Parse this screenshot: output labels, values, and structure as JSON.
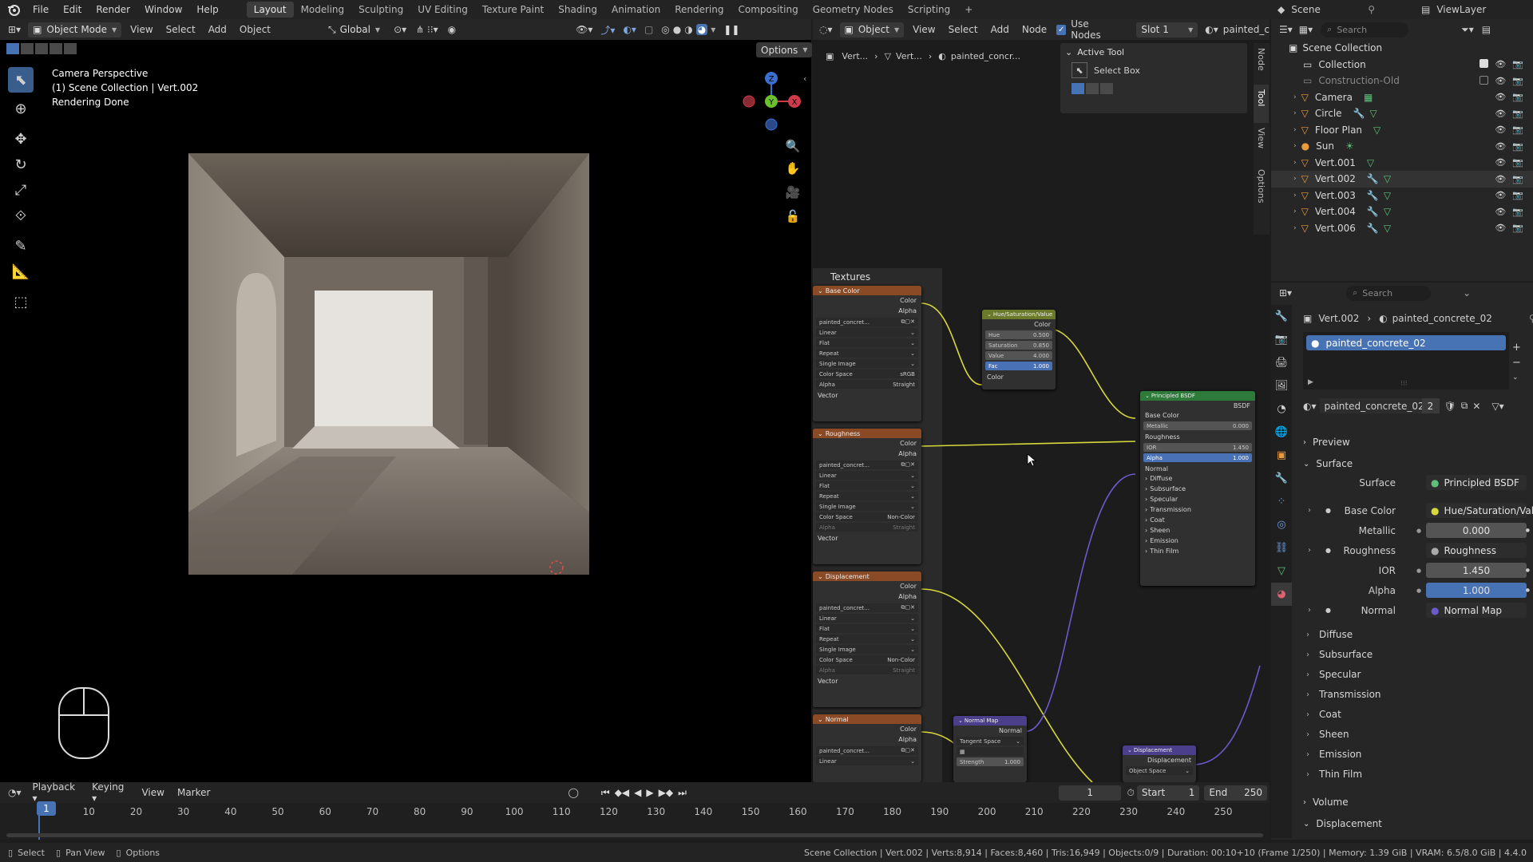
{
  "topbar": {
    "menus": [
      "File",
      "Edit",
      "Render",
      "Window",
      "Help"
    ],
    "workspaces": [
      "Layout",
      "Modeling",
      "Sculpting",
      "UV Editing",
      "Texture Paint",
      "Shading",
      "Animation",
      "Rendering",
      "Compositing",
      "Geometry Nodes",
      "Scripting"
    ],
    "active_workspace": "Layout",
    "scene": "Scene",
    "view_layer": "ViewLayer"
  },
  "viewport": {
    "mode": "Object Mode",
    "menus": [
      "View",
      "Select",
      "Add",
      "Object"
    ],
    "transform": "Global",
    "options_label": "Options",
    "info_line1": "Camera Perspective",
    "info_line2": "(1) Scene Collection | Vert.002",
    "info_line3": "Rendering Done",
    "gizmo_z": "Z",
    "gizmo_y": "Y",
    "gizmo_x": "X"
  },
  "node_editor": {
    "editor_type": "Object",
    "menus": [
      "View",
      "Select",
      "Add",
      "Node"
    ],
    "use_nodes_label": "Use Nodes",
    "slot": "Slot 1",
    "material_short": "painted_c",
    "breadcrumb": [
      "Vert...",
      "Vert...",
      "painted_concr..."
    ],
    "active_tool_title": "Active Tool",
    "select_box_label": "Select Box",
    "side_tabs": [
      "Node",
      "Tool",
      "View",
      "Options"
    ],
    "frame_label": "Textures",
    "texture_nodes": [
      {
        "title": "Base Color",
        "image": "painted_concret...",
        "interp": "Linear",
        "proj": "Flat",
        "ext": "Repeat",
        "source": "Single Image",
        "color_space_label": "Color Space",
        "color_space": "sRGB",
        "alpha_label": "Alpha",
        "alpha": "Straight",
        "vector": "Vector"
      },
      {
        "title": "Roughness",
        "image": "painted_concret...",
        "interp": "Linear",
        "proj": "Flat",
        "ext": "Repeat",
        "source": "Single Image",
        "color_space_label": "Color Space",
        "color_space": "Non-Color",
        "alpha_label": "Alpha",
        "alpha": "Straight",
        "vector": "Vector"
      },
      {
        "title": "Displacement",
        "image": "painted_concret...",
        "interp": "Linear",
        "proj": "Flat",
        "ext": "Repeat",
        "source": "Single Image",
        "color_space_label": "Color Space",
        "color_space": "Non-Color",
        "alpha_label": "Alpha",
        "alpha": "Straight",
        "vector": "Vector"
      },
      {
        "title": "Normal",
        "image": "painted_concret...",
        "interp": "Linear"
      }
    ],
    "output_color": "Color",
    "output_alpha": "Alpha",
    "hsv": {
      "title": "Hue/Saturation/Value",
      "out": "Color",
      "hue_label": "Hue",
      "hue": "0.500",
      "sat_label": "Saturation",
      "sat": "0.850",
      "val_label": "Value",
      "val": "4.000",
      "fac_label": "Fac",
      "fac": "1.000",
      "in": "Color"
    },
    "bsdf": {
      "title": "Principled BSDF",
      "out": "BSDF",
      "base_color": "Base Color",
      "metallic_label": "Metallic",
      "metallic": "0.000",
      "roughness": "Roughness",
      "ior_label": "IOR",
      "ior": "1.450",
      "alpha_label": "Alpha",
      "alpha": "1.000",
      "normal": "Normal",
      "panels": [
        "Diffuse",
        "Subsurface",
        "Specular",
        "Transmission",
        "Coat",
        "Sheen",
        "Emission",
        "Thin Film"
      ]
    },
    "normal_map": {
      "title": "Normal Map",
      "out": "Normal",
      "space": "Tangent Space",
      "strength_label": "Strength",
      "strength": "1.000"
    },
    "displacement": {
      "title": "Displacement",
      "out": "Displacement",
      "space": "Object Space"
    }
  },
  "outliner": {
    "search_placeholder": "Search",
    "root": "Scene Collection",
    "items": [
      {
        "name": "Collection",
        "type": "collection"
      },
      {
        "name": "Construction-Old",
        "type": "collection-off"
      },
      {
        "name": "Camera",
        "type": "camera"
      },
      {
        "name": "Circle",
        "type": "mesh"
      },
      {
        "name": "Floor Plan",
        "type": "mesh"
      },
      {
        "name": "Sun",
        "type": "light"
      },
      {
        "name": "Vert.001",
        "type": "mesh"
      },
      {
        "name": "Vert.002",
        "type": "mesh"
      },
      {
        "name": "Vert.003",
        "type": "mesh"
      },
      {
        "name": "Vert.004",
        "type": "mesh"
      },
      {
        "name": "Vert.006",
        "type": "mesh"
      }
    ]
  },
  "properties": {
    "search_placeholder": "Search",
    "breadcrumb_object": "Vert.002",
    "breadcrumb_material": "painted_concrete_02",
    "slot_name": "painted_concrete_02",
    "material_name": "painted_concrete_02",
    "users": "2",
    "preview": "Preview",
    "surface_section": "Surface",
    "rows": [
      {
        "label": "Surface",
        "value": "Principled BSDF"
      },
      {
        "label": "Base Color",
        "value": "Hue/Saturation/Value"
      },
      {
        "label": "Metallic",
        "value": "0.000"
      },
      {
        "label": "Roughness",
        "value": "Roughness"
      },
      {
        "label": "IOR",
        "value": "1.450"
      },
      {
        "label": "Alpha",
        "value": "1.000"
      },
      {
        "label": "Normal",
        "value": "Normal Map"
      }
    ],
    "subpanels": [
      "Diffuse",
      "Subsurface",
      "Specular",
      "Transmission",
      "Coat",
      "Sheen",
      "Emission",
      "Thin Film"
    ],
    "volume": "Volume",
    "displacement": "Displacement"
  },
  "timeline": {
    "menus": [
      "Playback",
      "Keying",
      "View",
      "Marker"
    ],
    "current_frame": "1",
    "start_label": "Start",
    "start": "1",
    "end_label": "End",
    "end": "250",
    "ticks": [
      "1",
      "10",
      "20",
      "30",
      "40",
      "50",
      "60",
      "70",
      "80",
      "90",
      "100",
      "110",
      "120",
      "130",
      "140",
      "150",
      "160",
      "170",
      "180",
      "190",
      "200",
      "210",
      "220",
      "230",
      "240",
      "250"
    ]
  },
  "statusbar": {
    "select": "Select",
    "pan": "Pan View",
    "options": "Options",
    "stats": "Scene Collection | Vert.002 | Verts:8,914 | Faces:8,460 | Tris:16,949 | Objects:0/9 | Duration: 00:10+10 (Frame 1/250) | Memory: 1.39 GiB | VRAM: 6.5/8.0 GiB | 4.4.0"
  },
  "colors": {
    "accent_blue": "#4772b3",
    "image_node_header": "#8a4a26",
    "hsv_header": "#6b7a2a",
    "bsdf_header": "#2d7a3a",
    "vector_node_header": "#4b3f8c",
    "link_yellow": "#d8d83a",
    "link_purple": "#6a5acd"
  }
}
